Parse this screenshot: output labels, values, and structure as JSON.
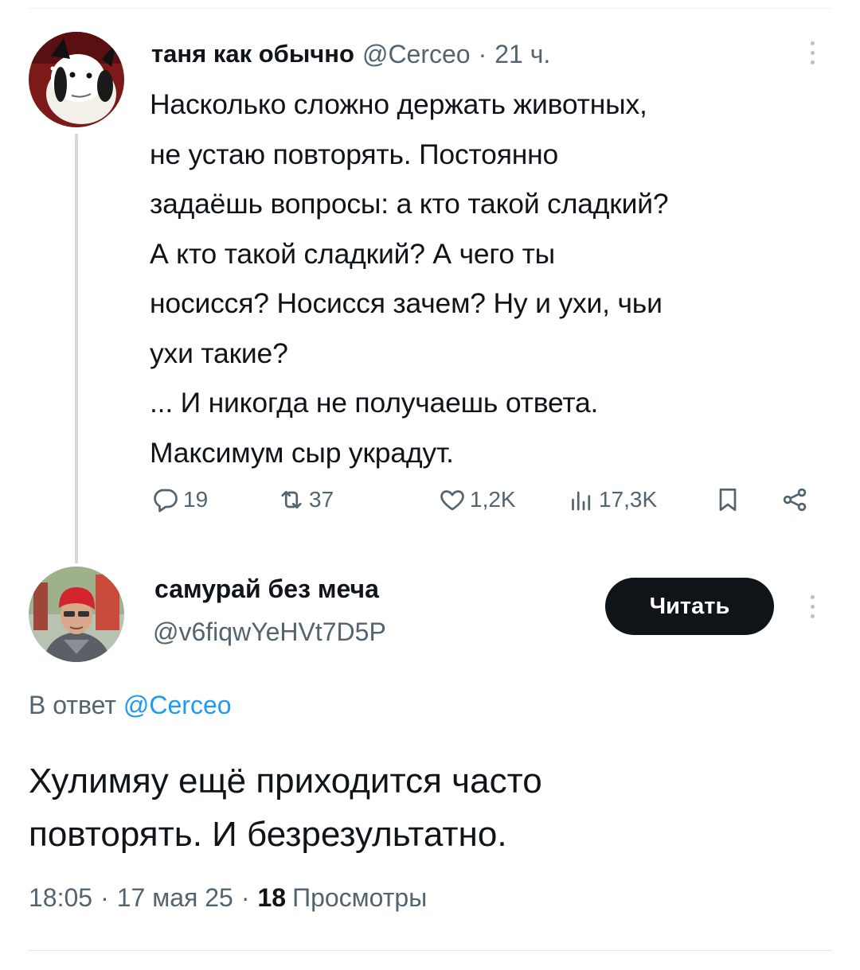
{
  "parent_tweet": {
    "author_name": "таня как обычно",
    "handle": "@Cerceo",
    "time": "21 ч.",
    "text": "Насколько сложно держать животных,\nне устаю повторять. Постоянно\nзадаёшь вопросы: а кто такой сладкий?\nА кто такой сладкий? А чего ты\nносисся? Носисся зачем? Ну и ухи, чьи\nухи такие?\n... И никогда не получаешь ответа.\nМаксимум сыр украдут.",
    "stats": {
      "replies": "19",
      "retweets": "37",
      "likes": "1,2K",
      "views": "17,3K"
    },
    "icons": {
      "reply": "reply-icon",
      "retweet": "retweet-icon",
      "like": "heart-icon",
      "views": "views-icon",
      "bookmark": "bookmark-icon",
      "share": "share-icon",
      "more": "more-vertical-icon"
    }
  },
  "reply_tweet": {
    "author_name": "самурай без меча",
    "handle": "@v6fiqwYeHVt7D5P",
    "follow_label": "Читать",
    "reply_to_prefix": "В ответ",
    "reply_to_handle": "@Cerceo",
    "text": "Хулимяу ещё приходится часто\nповторять. И безрезультатно.",
    "time": "18:05",
    "date": "17 мая 25",
    "views_count": "18",
    "views_label": "Просмотры"
  },
  "colors": {
    "text_primary": "#0f1419",
    "text_secondary": "#536471",
    "link": "#1d9bf0",
    "button_bg": "#0f1419",
    "thread_line": "#cfd9de"
  }
}
